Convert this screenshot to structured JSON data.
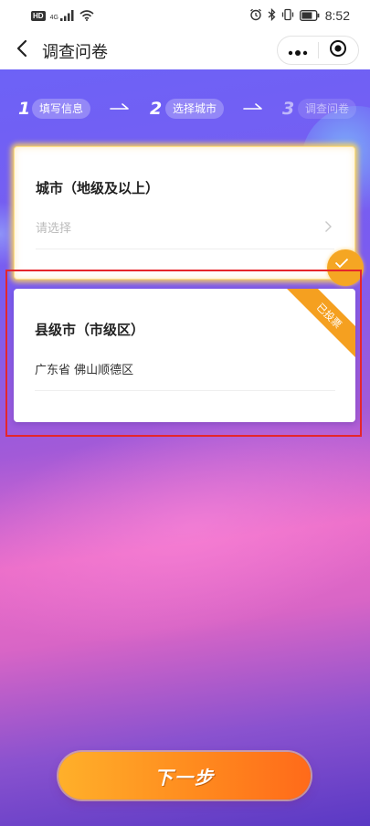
{
  "status_bar": {
    "hd_label": "HD",
    "network_type": "4G",
    "time": "8:52"
  },
  "nav": {
    "title": "调查问卷",
    "back_icon": "chevron-left-icon",
    "more_icon": "more-dots-icon",
    "close_icon": "record-target-icon"
  },
  "steps": [
    {
      "number": "1",
      "label": "填写信息",
      "state": "done"
    },
    {
      "number": "2",
      "label": "选择城市",
      "state": "active"
    },
    {
      "number": "3",
      "label": "调查问卷",
      "state": "pending"
    }
  ],
  "city_card": {
    "title": "城市（地级及以上）",
    "placeholder": "请选择"
  },
  "county_card": {
    "title": "县级市（市级区）",
    "value": "广东省 佛山顺德区",
    "badge": "已投票"
  },
  "next_button": {
    "label": "下一步"
  },
  "colors": {
    "accent_orange": "#f5a020",
    "highlight_red": "#e5262b",
    "bg_purple": "#6d62f6",
    "bg_pink": "#ea6cc8"
  }
}
